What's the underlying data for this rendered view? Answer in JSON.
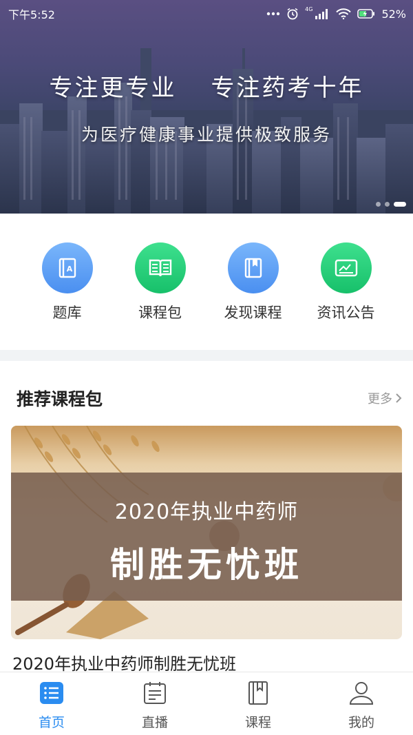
{
  "status_bar": {
    "time": "下午5:52",
    "network": "4G",
    "battery": "52%"
  },
  "banner": {
    "title_left": "专注更专业",
    "title_right": "专注药考十年",
    "subtitle": "为医疗健康事业提供极致服务",
    "slides": 3,
    "active_slide": 3
  },
  "quick_menu": [
    {
      "label": "题库",
      "icon": "question-bank-icon",
      "color": "#5a9ef5"
    },
    {
      "label": "课程包",
      "icon": "open-book-icon",
      "color": "#22c874"
    },
    {
      "label": "发现课程",
      "icon": "bookmark-book-icon",
      "color": "#5a9ef5"
    },
    {
      "label": "资讯公告",
      "icon": "announcement-icon",
      "color": "#22c874"
    }
  ],
  "recommended": {
    "title": "推荐课程包",
    "more": "更多",
    "course": {
      "banner_line1": "2020年执业中药师",
      "banner_line2": "制胜无忧班",
      "name": "2020年执业中药师制胜无忧班"
    }
  },
  "tab_bar": {
    "active_color": "#2a8cf0",
    "tabs": [
      {
        "label": "首页",
        "icon": "home-list-icon",
        "active": true
      },
      {
        "label": "直播",
        "icon": "live-clipboard-icon",
        "active": false
      },
      {
        "label": "课程",
        "icon": "course-book-icon",
        "active": false
      },
      {
        "label": "我的",
        "icon": "profile-icon",
        "active": false
      }
    ]
  }
}
